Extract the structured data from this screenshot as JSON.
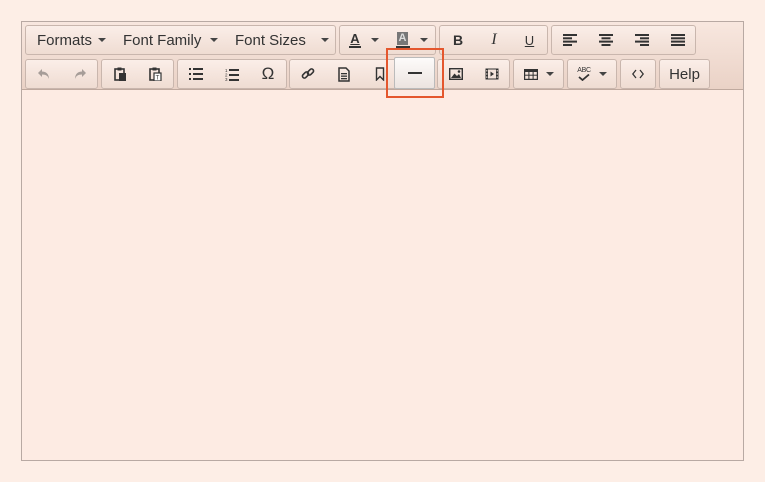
{
  "toolbar": {
    "row1": {
      "formats_label": "Formats",
      "font_family_label": "Font Family",
      "font_sizes_label": "Font Sizes",
      "text_color_glyph": "A",
      "bg_color_glyph": "A",
      "bold_glyph": "B",
      "italic_glyph": "I",
      "underline_glyph": "U"
    },
    "row2": {
      "help_label": "Help",
      "spellcheck_glyph": "ABC"
    }
  },
  "colors": {
    "page_bg": "#fdeee6",
    "highlight_border": "#e4572e"
  },
  "icons": [
    "undo-icon",
    "redo-icon",
    "paste-icon",
    "paste-text-icon",
    "bullet-list-icon",
    "numbered-list-icon",
    "omega-icon",
    "link-icon",
    "document-icon",
    "bookmark-icon",
    "horizontal-rule-icon",
    "image-icon",
    "media-icon",
    "table-icon",
    "spellcheck-icon",
    "code-icon"
  ]
}
